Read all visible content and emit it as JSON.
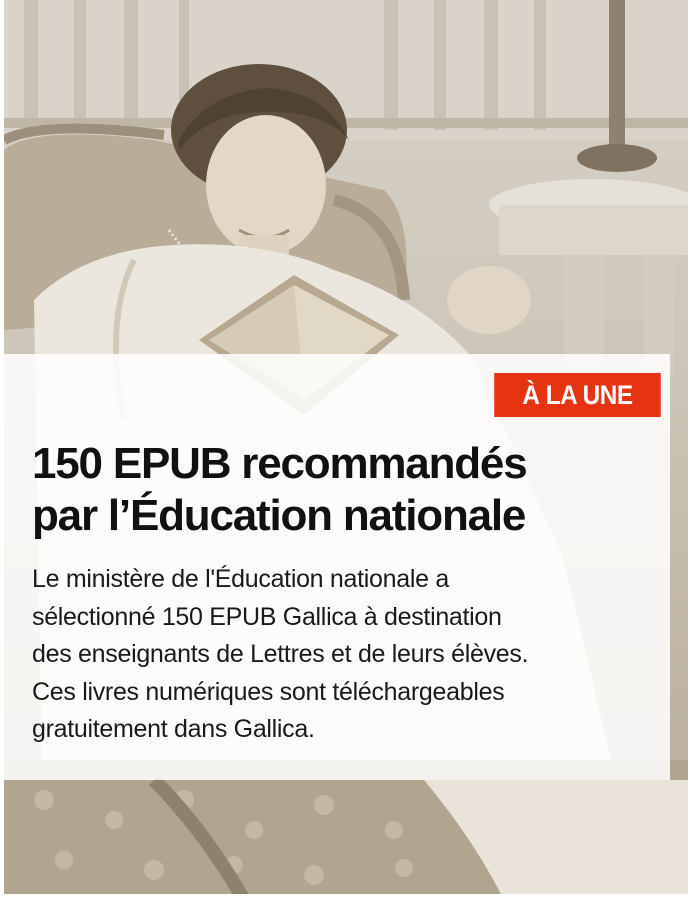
{
  "feature": {
    "badge_label": "À LA UNE",
    "title_lines": [
      "150 EPUB recommandés",
      "par l’Éducation nationale"
    ],
    "description_lines": [
      "Le ministère de l'Éducation nationale a",
      "sélectionné 150 EPUB Gallica à destination",
      "des enseignants de Lettres et de leurs élèves.",
      "Ces livres numériques sont téléchargeables",
      "gratuitement dans Gallica."
    ]
  },
  "colors": {
    "badge_background": "#e63312",
    "badge_text": "#ffffff",
    "title_text": "#111111",
    "overlay": "#ffffff",
    "photo_tone": "sepia"
  }
}
